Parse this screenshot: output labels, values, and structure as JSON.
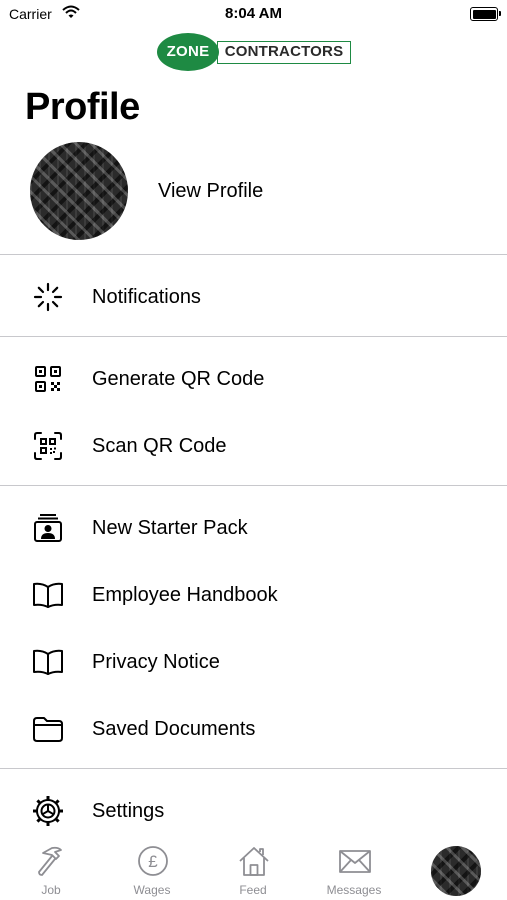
{
  "status_bar": {
    "carrier": "Carrier",
    "time": "8:04 AM"
  },
  "logo": {
    "part1": "ZONE",
    "part2": "CONTRACTORS"
  },
  "page": {
    "title": "Profile"
  },
  "profile": {
    "view_profile_label": "View Profile"
  },
  "menu": {
    "notifications": {
      "label": "Notifications",
      "icon": "spinner-icon"
    },
    "generate_qr": {
      "label": "Generate QR Code",
      "icon": "qr-code-icon"
    },
    "scan_qr": {
      "label": "Scan QR Code",
      "icon": "qr-scan-icon"
    },
    "new_starter": {
      "label": "New Starter Pack",
      "icon": "id-badge-icon"
    },
    "handbook": {
      "label": "Employee Handbook",
      "icon": "book-icon"
    },
    "privacy": {
      "label": "Privacy Notice",
      "icon": "book-icon"
    },
    "saved_docs": {
      "label": "Saved Documents",
      "icon": "folder-icon"
    },
    "settings": {
      "label": "Settings",
      "icon": "gear-icon"
    }
  },
  "tabs": {
    "job": {
      "label": "Job",
      "icon": "hammer-icon"
    },
    "wages": {
      "label": "Wages",
      "icon": "pound-icon"
    },
    "feed": {
      "label": "Feed",
      "icon": "home-icon"
    },
    "messages": {
      "label": "Messages",
      "icon": "envelope-icon"
    },
    "profile": {
      "icon": "avatar"
    }
  },
  "colors": {
    "brand_green": "#1e8a43",
    "tab_inactive": "#8e8e93",
    "divider": "#c8c8cc"
  }
}
